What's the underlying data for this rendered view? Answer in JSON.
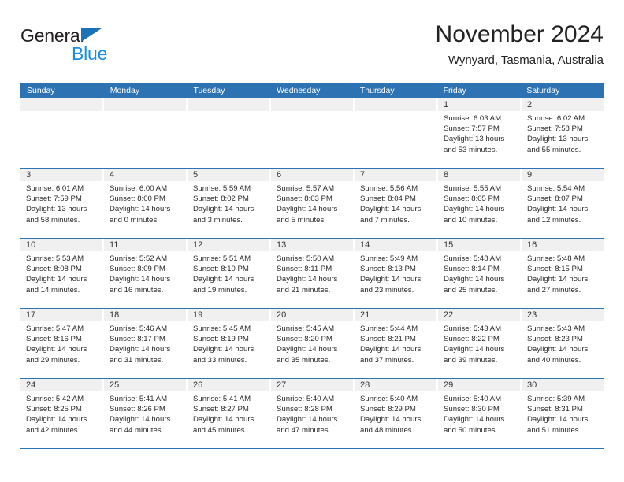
{
  "logo": {
    "word1": "General",
    "word2": "Blue",
    "triangle_color": "#1a72b8",
    "word2_color": "#1a8fe0"
  },
  "header": {
    "title": "November 2024",
    "subtitle": "Wynyard, Tasmania, Australia"
  },
  "theme": {
    "header_blue": "#2d72b3",
    "daynum_band": "#f0f0f0"
  },
  "weekday_headers": [
    "Sunday",
    "Monday",
    "Tuesday",
    "Wednesday",
    "Thursday",
    "Friday",
    "Saturday"
  ],
  "weeks": [
    [
      {
        "day": "",
        "empty": true
      },
      {
        "day": "",
        "empty": true
      },
      {
        "day": "",
        "empty": true
      },
      {
        "day": "",
        "empty": true
      },
      {
        "day": "",
        "empty": true
      },
      {
        "day": "1",
        "sunrise": "Sunrise: 6:03 AM",
        "sunset": "Sunset: 7:57 PM",
        "daylight1": "Daylight: 13 hours",
        "daylight2": "and 53 minutes."
      },
      {
        "day": "2",
        "sunrise": "Sunrise: 6:02 AM",
        "sunset": "Sunset: 7:58 PM",
        "daylight1": "Daylight: 13 hours",
        "daylight2": "and 55 minutes."
      }
    ],
    [
      {
        "day": "3",
        "sunrise": "Sunrise: 6:01 AM",
        "sunset": "Sunset: 7:59 PM",
        "daylight1": "Daylight: 13 hours",
        "daylight2": "and 58 minutes."
      },
      {
        "day": "4",
        "sunrise": "Sunrise: 6:00 AM",
        "sunset": "Sunset: 8:00 PM",
        "daylight1": "Daylight: 14 hours",
        "daylight2": "and 0 minutes."
      },
      {
        "day": "5",
        "sunrise": "Sunrise: 5:59 AM",
        "sunset": "Sunset: 8:02 PM",
        "daylight1": "Daylight: 14 hours",
        "daylight2": "and 3 minutes."
      },
      {
        "day": "6",
        "sunrise": "Sunrise: 5:57 AM",
        "sunset": "Sunset: 8:03 PM",
        "daylight1": "Daylight: 14 hours",
        "daylight2": "and 5 minutes."
      },
      {
        "day": "7",
        "sunrise": "Sunrise: 5:56 AM",
        "sunset": "Sunset: 8:04 PM",
        "daylight1": "Daylight: 14 hours",
        "daylight2": "and 7 minutes."
      },
      {
        "day": "8",
        "sunrise": "Sunrise: 5:55 AM",
        "sunset": "Sunset: 8:05 PM",
        "daylight1": "Daylight: 14 hours",
        "daylight2": "and 10 minutes."
      },
      {
        "day": "9",
        "sunrise": "Sunrise: 5:54 AM",
        "sunset": "Sunset: 8:07 PM",
        "daylight1": "Daylight: 14 hours",
        "daylight2": "and 12 minutes."
      }
    ],
    [
      {
        "day": "10",
        "sunrise": "Sunrise: 5:53 AM",
        "sunset": "Sunset: 8:08 PM",
        "daylight1": "Daylight: 14 hours",
        "daylight2": "and 14 minutes."
      },
      {
        "day": "11",
        "sunrise": "Sunrise: 5:52 AM",
        "sunset": "Sunset: 8:09 PM",
        "daylight1": "Daylight: 14 hours",
        "daylight2": "and 16 minutes."
      },
      {
        "day": "12",
        "sunrise": "Sunrise: 5:51 AM",
        "sunset": "Sunset: 8:10 PM",
        "daylight1": "Daylight: 14 hours",
        "daylight2": "and 19 minutes."
      },
      {
        "day": "13",
        "sunrise": "Sunrise: 5:50 AM",
        "sunset": "Sunset: 8:11 PM",
        "daylight1": "Daylight: 14 hours",
        "daylight2": "and 21 minutes."
      },
      {
        "day": "14",
        "sunrise": "Sunrise: 5:49 AM",
        "sunset": "Sunset: 8:13 PM",
        "daylight1": "Daylight: 14 hours",
        "daylight2": "and 23 minutes."
      },
      {
        "day": "15",
        "sunrise": "Sunrise: 5:48 AM",
        "sunset": "Sunset: 8:14 PM",
        "daylight1": "Daylight: 14 hours",
        "daylight2": "and 25 minutes."
      },
      {
        "day": "16",
        "sunrise": "Sunrise: 5:48 AM",
        "sunset": "Sunset: 8:15 PM",
        "daylight1": "Daylight: 14 hours",
        "daylight2": "and 27 minutes."
      }
    ],
    [
      {
        "day": "17",
        "sunrise": "Sunrise: 5:47 AM",
        "sunset": "Sunset: 8:16 PM",
        "daylight1": "Daylight: 14 hours",
        "daylight2": "and 29 minutes."
      },
      {
        "day": "18",
        "sunrise": "Sunrise: 5:46 AM",
        "sunset": "Sunset: 8:17 PM",
        "daylight1": "Daylight: 14 hours",
        "daylight2": "and 31 minutes."
      },
      {
        "day": "19",
        "sunrise": "Sunrise: 5:45 AM",
        "sunset": "Sunset: 8:19 PM",
        "daylight1": "Daylight: 14 hours",
        "daylight2": "and 33 minutes."
      },
      {
        "day": "20",
        "sunrise": "Sunrise: 5:45 AM",
        "sunset": "Sunset: 8:20 PM",
        "daylight1": "Daylight: 14 hours",
        "daylight2": "and 35 minutes."
      },
      {
        "day": "21",
        "sunrise": "Sunrise: 5:44 AM",
        "sunset": "Sunset: 8:21 PM",
        "daylight1": "Daylight: 14 hours",
        "daylight2": "and 37 minutes."
      },
      {
        "day": "22",
        "sunrise": "Sunrise: 5:43 AM",
        "sunset": "Sunset: 8:22 PM",
        "daylight1": "Daylight: 14 hours",
        "daylight2": "and 39 minutes."
      },
      {
        "day": "23",
        "sunrise": "Sunrise: 5:43 AM",
        "sunset": "Sunset: 8:23 PM",
        "daylight1": "Daylight: 14 hours",
        "daylight2": "and 40 minutes."
      }
    ],
    [
      {
        "day": "24",
        "sunrise": "Sunrise: 5:42 AM",
        "sunset": "Sunset: 8:25 PM",
        "daylight1": "Daylight: 14 hours",
        "daylight2": "and 42 minutes."
      },
      {
        "day": "25",
        "sunrise": "Sunrise: 5:41 AM",
        "sunset": "Sunset: 8:26 PM",
        "daylight1": "Daylight: 14 hours",
        "daylight2": "and 44 minutes."
      },
      {
        "day": "26",
        "sunrise": "Sunrise: 5:41 AM",
        "sunset": "Sunset: 8:27 PM",
        "daylight1": "Daylight: 14 hours",
        "daylight2": "and 45 minutes."
      },
      {
        "day": "27",
        "sunrise": "Sunrise: 5:40 AM",
        "sunset": "Sunset: 8:28 PM",
        "daylight1": "Daylight: 14 hours",
        "daylight2": "and 47 minutes."
      },
      {
        "day": "28",
        "sunrise": "Sunrise: 5:40 AM",
        "sunset": "Sunset: 8:29 PM",
        "daylight1": "Daylight: 14 hours",
        "daylight2": "and 48 minutes."
      },
      {
        "day": "29",
        "sunrise": "Sunrise: 5:40 AM",
        "sunset": "Sunset: 8:30 PM",
        "daylight1": "Daylight: 14 hours",
        "daylight2": "and 50 minutes."
      },
      {
        "day": "30",
        "sunrise": "Sunrise: 5:39 AM",
        "sunset": "Sunset: 8:31 PM",
        "daylight1": "Daylight: 14 hours",
        "daylight2": "and 51 minutes."
      }
    ]
  ]
}
